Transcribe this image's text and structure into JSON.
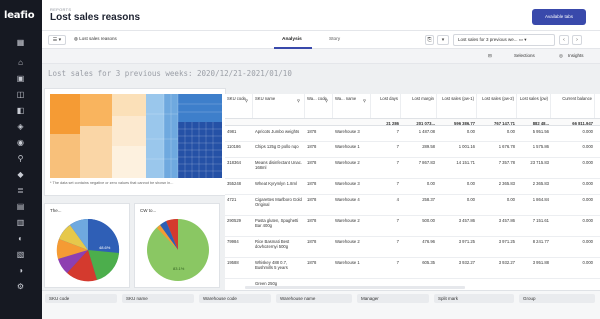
{
  "app": {
    "logo": "leafio"
  },
  "sidebar": {
    "icons": [
      "grid-icon",
      "home-icon",
      "package-icon",
      "cart-icon",
      "report-icon",
      "rocket-icon",
      "lock-icon",
      "search-icon",
      "tag-icon",
      "layers-icon",
      "grid-small-icon",
      "wallet-icon",
      "shield-icon",
      "chart-icon",
      "list-icon",
      "gear-icon"
    ]
  },
  "header": {
    "breadcrumb": "REPORTS",
    "title": "Lost sales reasons",
    "available_tabs": "Available tabs"
  },
  "toolbar": {
    "sheet_name": "Lost sales reasons",
    "tabs": [
      "Analysis",
      "Story"
    ],
    "active_tab": "Analysis",
    "sheet_select": "Lost sales for 3 previous we..."
  },
  "subbar": {
    "selections": "Selections",
    "insights": "Insights"
  },
  "sheet": {
    "title": "Lost sales for 3 previous weeks: 2020/12/21-2021/01/10",
    "treemap_note": "* The data set contains negative or zero values that cannot be shown in..."
  },
  "pies": [
    {
      "title": "The...",
      "label": "48.6%"
    },
    {
      "title": "CW to...",
      "label": "83.1%"
    }
  ],
  "table": {
    "headers": [
      "SKU code",
      "SKU name",
      "Wa... code",
      "Wa... name",
      "Lost days",
      "Lost margin",
      "Lost sales (pw-1)",
      "Lost sales (pw-2)",
      "Lost sales (pw)",
      "Current balance"
    ],
    "totals": [
      "",
      "",
      "",
      "",
      "21 286",
      "201 073...",
      "596 386.77",
      "767 147.71",
      "882 48...",
      "66 811.947"
    ],
    "rows": [
      [
        "4981",
        "Apricots Jumbo weights",
        "1878",
        "Warehouse 3",
        "7",
        "1 487.08",
        "0.00",
        "0.00",
        "5 951.56",
        "0.000"
      ],
      [
        "110186",
        "Chips 125g D pollo nqo",
        "1878",
        "Warehouse 1",
        "7",
        "289.58",
        "1 001.16",
        "1 676.78",
        "1 575.86",
        "0.000"
      ],
      [
        "318364",
        "Means disinfectant Unac. 168ml",
        "1878",
        "Warehouse 2",
        "7",
        "7 867.83",
        "14 151.71",
        "7 357.78",
        "23 715.83",
        "0.000"
      ],
      [
        "355248",
        "Wheat Kyrymlyn 1.8ml",
        "1878",
        "Warehouse 3",
        "7",
        "0.00",
        "0.00",
        "2 365.83",
        "2 365.83",
        "0.000"
      ],
      [
        "4721",
        "Cigarettes Marlboro Gold Original",
        "1878",
        "Warehouse 4",
        "4",
        "258.37",
        "0.00",
        "0.00",
        "1 864.84",
        "0.000"
      ],
      [
        "290529",
        "Pasta gluten, Spaghetti Bar 400g",
        "1878",
        "Warehouse 2",
        "7",
        "500.00",
        "3 457.86",
        "3 457.86",
        "7 151.61",
        "0.000"
      ],
      [
        "79984",
        "Rice Basmati Best dovhozernyi 500g",
        "1878",
        "Warehouse 2",
        "7",
        "476.96",
        "3 971.25",
        "3 971.25",
        "8 241.77",
        "0.000"
      ],
      [
        "19588",
        "Whiskey 488 0.7, Bushmills 5 years",
        "1878",
        "Warehouse 1",
        "7",
        "605.35",
        "3 932.27",
        "3 932.27",
        "3 951.88",
        "0.000"
      ],
      [
        "",
        "Green 250g",
        "",
        "",
        "",
        "",
        "",
        "",
        "",
        ""
      ]
    ]
  },
  "filters": [
    "SKU code",
    "SKU name",
    "Warehouse code",
    "Warehouse name",
    "Manager",
    "Split mark",
    "Group"
  ]
}
